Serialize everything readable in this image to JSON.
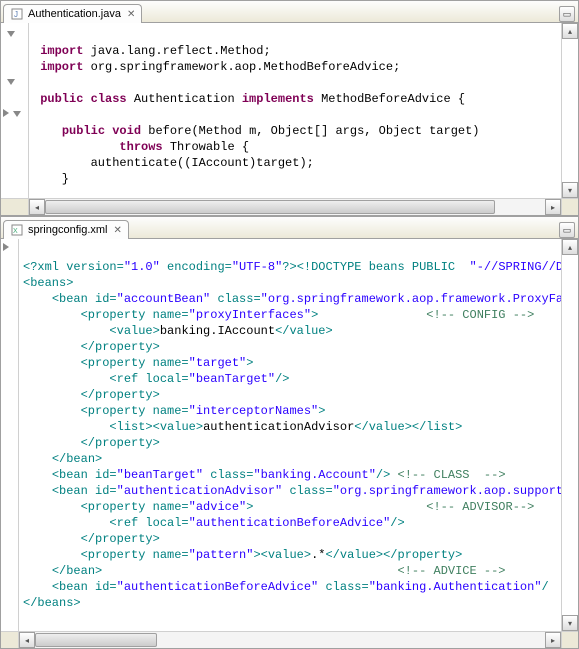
{
  "panes": {
    "top": {
      "tab": {
        "label": "Authentication.java"
      },
      "code": {
        "l1": {
          "kw1": "import",
          "rest": " java.lang.reflect.Method;"
        },
        "l2": {
          "kw1": "import",
          "rest": " org.springframework.aop.MethodBeforeAdvice;"
        },
        "l3": "",
        "l4": {
          "kw1": "public",
          "kw2": "class",
          "name": " Authentication ",
          "kw3": "implements",
          "rest": " MethodBeforeAdvice {"
        },
        "l5": "",
        "l6": {
          "kw1": "public",
          "kw2": "void",
          "rest": " before(Method m, Object[] args, Object target)"
        },
        "l7": {
          "kw1": "throws",
          "rest": " Throwable {"
        },
        "l8": "        authenticate((IAccount)target);",
        "l9": "    }"
      }
    },
    "bot": {
      "tab": {
        "label": "springconfig.xml"
      },
      "xml": {
        "decl_open": "<?xml version=",
        "decl_ver": "\"1.0\"",
        "decl_enc_k": " encoding=",
        "decl_enc_v": "\"UTF-8\"",
        "decl_close": "?>",
        "doctype": "<!DOCTYPE beans PUBLIC  ",
        "doctype_s": "\"-//SPRING//D",
        "beans_open": "<beans>",
        "bean1_open": "<bean id=",
        "bean1_id": "\"accountBean\"",
        "class_k": " class=",
        "bean1_class": "\"org.springframework.aop.framework.ProxyFa",
        "prop_open": "<property name=",
        "prop1_name": "\"proxyInterfaces\"",
        "prop_gt": ">",
        "c_config": "<!-- CONFIG -->",
        "value_open": "<value>",
        "value1": "banking.IAccount",
        "value_close": "</value>",
        "prop_close": "</property>",
        "prop2_name": "\"target\"",
        "ref_open": "<ref local=",
        "ref1_v": "\"beanTarget\"",
        "ref_close": "/>",
        "prop3_name": "\"interceptorNames\"",
        "list_open": "<list>",
        "val2": "authenticationAdvisor",
        "list_close": "</list>",
        "bean_close": "</bean>",
        "bean2_id": "\"beanTarget\"",
        "bean2_class": "\"banking.Account\"",
        "bean_sc": "/>",
        "c_class": "<!-- CLASS  -->",
        "bean3_id": "\"authenticationAdvisor\"",
        "bean3_class": "\"org.springframework.aop.support",
        "prop4_name": "\"advice\"",
        "c_advisor": "<!-- ADVISOR-->",
        "ref2_v": "\"authenticationBeforeAdvice\"",
        "prop5_name": "\"pattern\"",
        "val3": ".*",
        "c_advice": "<!-- ADVICE -->",
        "bean4_id": "\"authenticationBeforeAdvice\"",
        "bean4_class": "\"banking.Authentication\"",
        "bean4_sc": "/",
        "beans_close": "</beans>"
      }
    }
  }
}
